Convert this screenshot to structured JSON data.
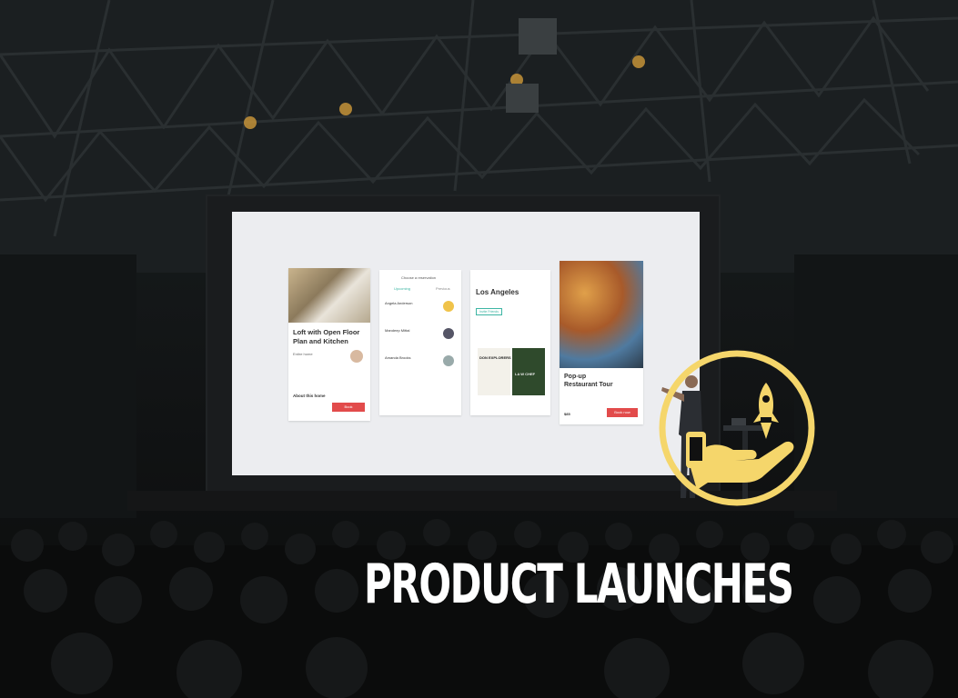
{
  "headline": "PRODUCT LAUNCHES",
  "badge": {
    "icons": [
      "rocket-icon",
      "hand-icon",
      "phone-icon"
    ],
    "color": "#f5d66b"
  },
  "slide": {
    "card1": {
      "title_line1": "Loft with Open Floor",
      "title_line2": "Plan and Kitchen",
      "subtitle": "Entire home",
      "section": "About this home",
      "button": "Book"
    },
    "card2": {
      "header": "Choose a reservation",
      "tab1": "Upcoming",
      "tab2": "Previous",
      "names": [
        "Angela Anderson",
        "Mandeep Mittal",
        "Amanda Brooks"
      ]
    },
    "card3": {
      "city": "Los Angeles",
      "chip": "Invite Friends",
      "book1": "DON EXPLORERS",
      "book2": "LA W CHEF"
    },
    "card4": {
      "title_line1": "Pop-up",
      "title_line2": "Restaurant Tour",
      "price": "$85",
      "button": "Book now"
    }
  },
  "colors": {
    "accent": "#e24b4b",
    "teal": "#3eb6a4",
    "badge": "#f5d66b"
  }
}
